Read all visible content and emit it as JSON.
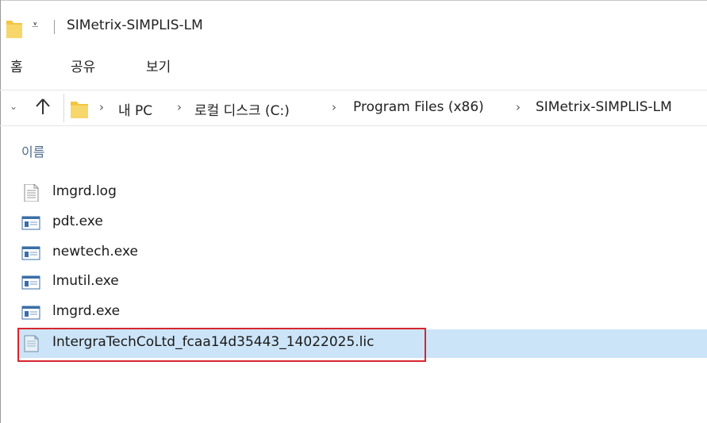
{
  "window": {
    "title": "SIMetrix-SIMPLIS-LM",
    "quick_access_glyph": "⩡"
  },
  "ribbon": {
    "tabs": [
      {
        "label": "홈"
      },
      {
        "label": "공유"
      },
      {
        "label": "보기"
      }
    ]
  },
  "address_bar": {
    "back_glyph": "⌄",
    "up_glyph": "🡡",
    "breadcrumb": [
      "내 PC",
      "로컬 디스크 (C:)",
      "Program Files (x86)",
      "SIMetrix-SIMPLIS-LM"
    ],
    "separator": "›"
  },
  "file_list": {
    "column_header": "이름",
    "files": [
      {
        "name": "lmgrd.log",
        "icon": "text-file-icon"
      },
      {
        "name": "pdt.exe",
        "icon": "exe-icon"
      },
      {
        "name": "newtech.exe",
        "icon": "exe-icon"
      },
      {
        "name": "lmutil.exe",
        "icon": "exe-icon"
      },
      {
        "name": "lmgrd.exe",
        "icon": "exe-icon"
      },
      {
        "name": "IntergraTechCoLtd_fcaa14d35443_14022025.lic",
        "icon": "license-file-icon",
        "selected": true
      }
    ]
  },
  "colors": {
    "selection": "#cce4f7",
    "highlight_border": "#d9252f",
    "folder_yellow": "#f4c542",
    "column_header_text": "#4d6a8a"
  }
}
